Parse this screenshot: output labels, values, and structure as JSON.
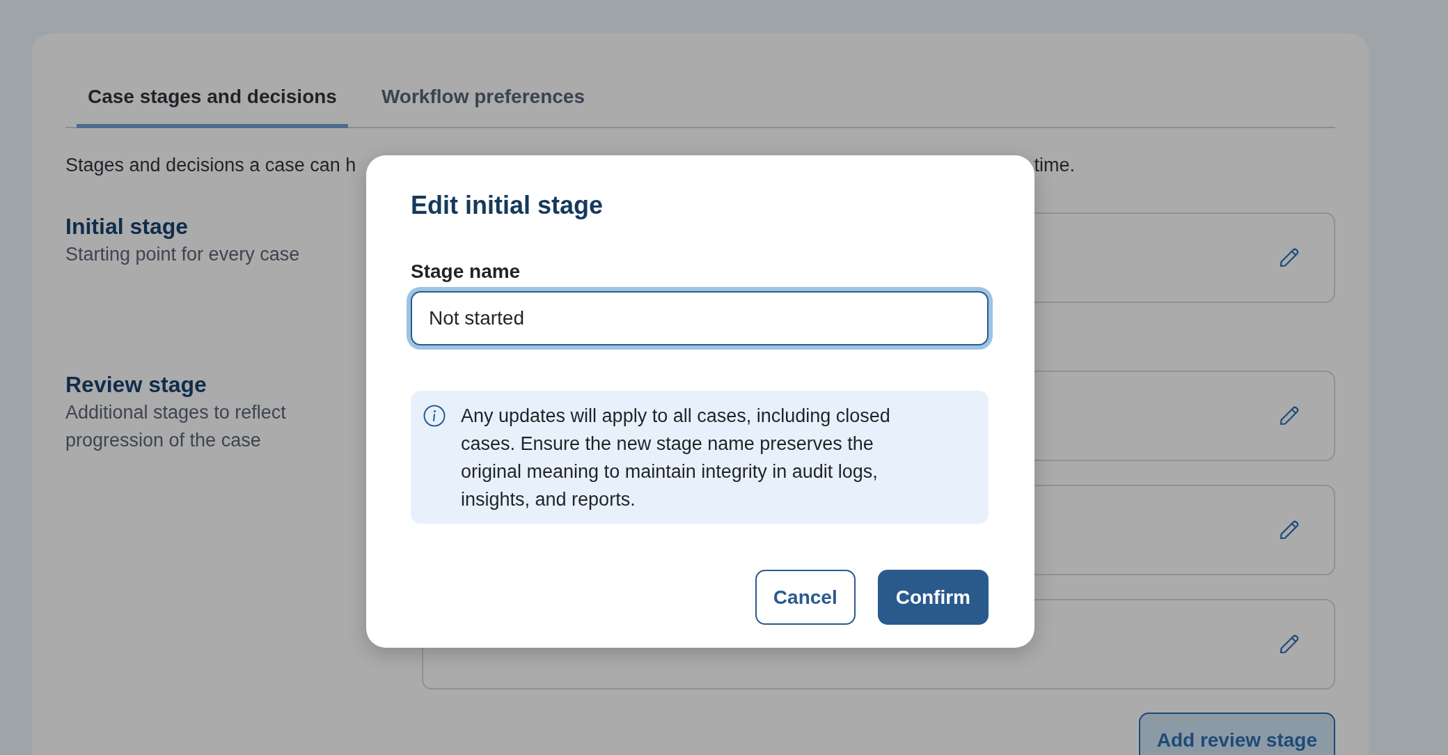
{
  "tabs": [
    {
      "label": "Case stages and decisions",
      "selected": true
    },
    {
      "label": "Workflow preferences",
      "selected": false
    }
  ],
  "description": {
    "before_dialog": "Stages and decisions a case can h",
    "after_dialog": "time."
  },
  "sections": [
    {
      "title": "Initial stage",
      "subtitle": "Starting point for every case",
      "cards": [
        {
          "kind": "editable"
        }
      ]
    },
    {
      "title": "Review stage",
      "subtitle": "Additional stages to reflect progression of the case",
      "cards": [
        {
          "kind": "editable"
        },
        {
          "kind": "editable"
        },
        {
          "kind": "editable"
        }
      ]
    }
  ],
  "add_button": "Add review stage",
  "dialog": {
    "title": "Edit initial stage",
    "field": {
      "label": "Stage name",
      "value": "Not started",
      "focused": true
    },
    "notice": "Any updates will apply to all cases, including closed cases. Ensure the new stage name preserves the original meaning to maintain integrity in audit logs, insights, and reports.",
    "buttons": [
      {
        "label": "Cancel",
        "kind": "secondary"
      },
      {
        "label": "Confirm",
        "kind": "primary"
      }
    ]
  }
}
